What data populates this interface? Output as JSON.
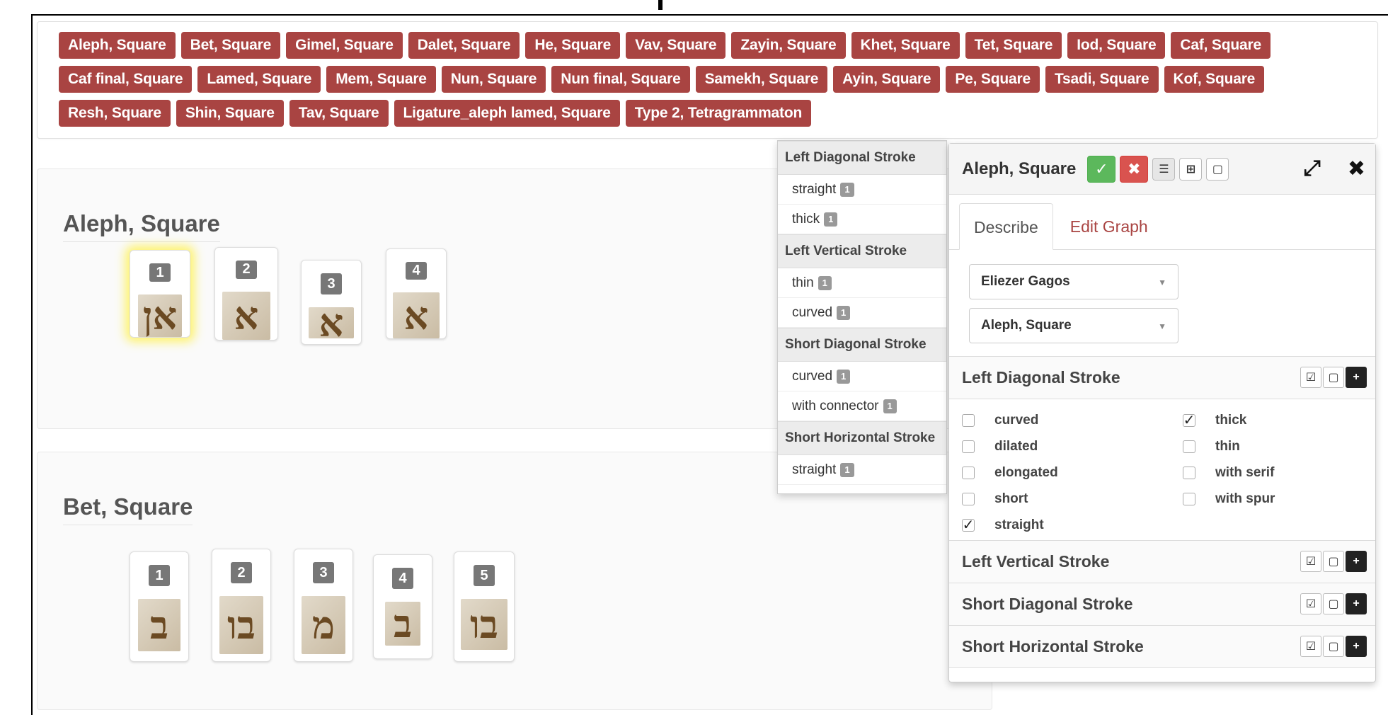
{
  "tags": [
    "Aleph, Square",
    "Bet, Square",
    "Gimel, Square",
    "Dalet, Square",
    "He, Square",
    "Vav, Square",
    "Zayin, Square",
    "Khet, Square",
    "Tet, Square",
    "Iod, Square",
    "Caf, Square",
    "Caf final, Square",
    "Lamed, Square",
    "Mem, Square",
    "Nun, Square",
    "Nun final, Square",
    "Samekh, Square",
    "Ayin, Square",
    "Pe, Square",
    "Tsadi, Square",
    "Kof, Square",
    "Resh, Square",
    "Shin, Square",
    "Tav, Square",
    "Ligature_aleph lamed, Square",
    "Type 2, Tetragrammaton"
  ],
  "panels": {
    "aleph": {
      "title": "Aleph, Square",
      "thumbs": [
        "1",
        "2",
        "3",
        "4"
      ],
      "glyphs": [
        "אן",
        "א",
        "אׄ",
        "א"
      ]
    },
    "bet": {
      "title": "Bet, Square",
      "thumbs": [
        "1",
        "2",
        "3",
        "4",
        "5"
      ],
      "glyphs": [
        "ב",
        "בו",
        "מ",
        "ב",
        "בו"
      ]
    }
  },
  "summary": {
    "groups": [
      {
        "header": "Left Diagonal Stroke",
        "rows": [
          {
            "label": "straight",
            "count": "1"
          },
          {
            "label": "thick",
            "count": "1"
          }
        ]
      },
      {
        "header": "Left Vertical Stroke",
        "rows": [
          {
            "label": "thin",
            "count": "1"
          },
          {
            "label": "curved",
            "count": "1"
          }
        ]
      },
      {
        "header": "Short Diagonal Stroke",
        "rows": [
          {
            "label": "curved",
            "count": "1"
          },
          {
            "label": "with connector",
            "count": "1"
          }
        ]
      },
      {
        "header": "Short Horizontal Stroke",
        "rows": [
          {
            "label": "straight",
            "count": "1"
          }
        ]
      }
    ]
  },
  "editor": {
    "title": "Aleph, Square",
    "tabs": [
      "Describe",
      "Edit Graph"
    ],
    "hand_select": "Eliezer Gagos",
    "allograph_select": "Aleph, Square",
    "sections": [
      "Left Diagonal Stroke",
      "Left Vertical Stroke",
      "Short Diagonal Stroke",
      "Short Horizontal Stroke"
    ],
    "attributes_left": [
      {
        "label": "curved",
        "checked": false
      },
      {
        "label": "dilated",
        "checked": false
      },
      {
        "label": "elongated",
        "checked": false
      },
      {
        "label": "short",
        "checked": false
      },
      {
        "label": "straight",
        "checked": true
      }
    ],
    "attributes_right": [
      {
        "label": "thick",
        "checked": true
      },
      {
        "label": "thin",
        "checked": false
      },
      {
        "label": "with serif",
        "checked": false
      },
      {
        "label": "with spur",
        "checked": false
      }
    ]
  },
  "icons": {
    "ok": "check-icon",
    "cancel": "x-icon",
    "list": "list-icon",
    "plus": "plus-square-icon",
    "square": "square-icon",
    "expand": "expand-icon",
    "close": "close-icon"
  },
  "colors": {
    "tag": "#a94442",
    "ok": "#5cb85c",
    "cancel": "#d9534f"
  }
}
